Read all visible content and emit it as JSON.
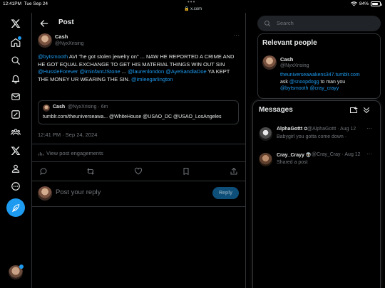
{
  "status_bar": {
    "time": "12:41PM",
    "date": "Tue Sep 24",
    "url": "x.com",
    "battery": "84%",
    "battery_level": 0.84
  },
  "nav": {
    "items": [
      "x-logo-icon",
      "home-icon",
      "search-icon",
      "notifications-icon",
      "messages-icon",
      "grok-icon",
      "communities-icon",
      "premium-icon",
      "profile-icon",
      "more-icon"
    ]
  },
  "header": {
    "title": "Post"
  },
  "post": {
    "author_name": "Cash",
    "author_handle": "@NyxXrising",
    "more": "···",
    "text": {
      "m1": "@bytsmooth",
      "t1": " AVI \"he got stolen jewelry on\" ... NAW HE REPORTED A CRIME AND HE GOT EQUAL EXCHANGE TO GET HIS MATERIAL THINGS WIN OUT SIN ",
      "m2": "@HussleForever",
      "m3": "@iminfantJStone",
      "t2": " ... ",
      "m4": "@laurenlondon",
      "m5": "@AyeSandiaDoe",
      "t3": " YA KEPT THE MONEY UR WEARING THE SIN. ",
      "m6": "@imleegarlington"
    },
    "quote": {
      "name": "Cash",
      "handle": "@NyxXrising · 6m",
      "text": "tumblr.com/theuniverseawa... @WhiteHouse @USAO_DC @USAO_LosAngeles"
    },
    "timestamp": "12:41 PM · Sep 24, 2024",
    "engagements": "View post engagements"
  },
  "reply": {
    "placeholder": "Post your reply",
    "button": "Reply"
  },
  "search": {
    "placeholder": "Search"
  },
  "relevant": {
    "title": "Relevant people",
    "name": "Cash",
    "handle": "@NyxXrising",
    "bio_link": "theuniverseawakens347.tumblr.com",
    "bio_t1": "ask ",
    "bio_m1": "@snoopdogg",
    "bio_t2": " to man you ",
    "bio_m2": "@bytsmooth",
    "bio_m3": "@cray_crayy"
  },
  "messages": {
    "title": "Messages",
    "conversations": [
      {
        "name": "AlphaGottt",
        "meta": "@AlphaGottt · Aug 12",
        "preview": "Babygirl you gotta come down ·",
        "more": "···"
      },
      {
        "name": "Cray_Crayy",
        "meta": "@Cray_Cray · Aug 12",
        "preview": "Shared a post",
        "more": "···"
      }
    ]
  },
  "colors": {
    "accent": "#1d9bf0",
    "background": "#000000",
    "border": "#2f3336",
    "muted_text": "#71767b"
  }
}
